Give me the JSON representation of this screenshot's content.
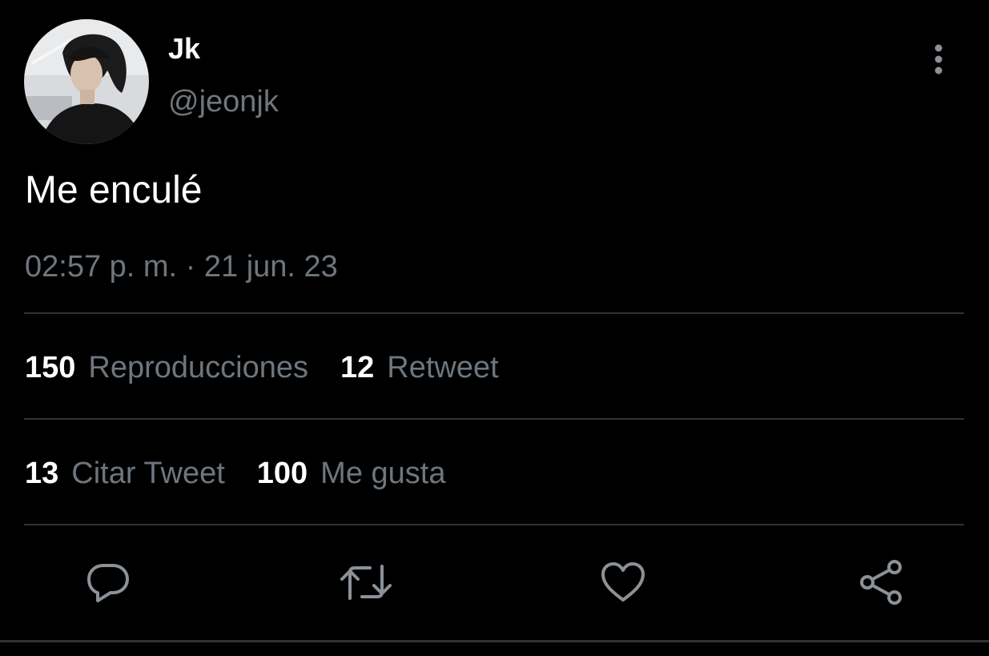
{
  "user": {
    "display_name": "Jk",
    "handle": "@jeonjk",
    "avatar": "avatar-photo"
  },
  "tweet": {
    "text": "Me enculé",
    "timestamp": "02:57 p. m. · 21 jun. 23"
  },
  "stats": {
    "views_count": "150",
    "views_label": "Reproducciones",
    "retweets_count": "12",
    "retweets_label": "Retweet",
    "quotes_count": "13",
    "quotes_label": "Citar Tweet",
    "likes_count": "100",
    "likes_label": "Me gusta"
  },
  "actions": [
    {
      "icon": "reply-icon"
    },
    {
      "icon": "retweet-icon"
    },
    {
      "icon": "like-icon"
    },
    {
      "icon": "share-icon"
    }
  ],
  "colors": {
    "background": "#000000",
    "primary_text": "#ffffff",
    "secondary_text": "#6e767d",
    "divider": "#2f3336"
  }
}
